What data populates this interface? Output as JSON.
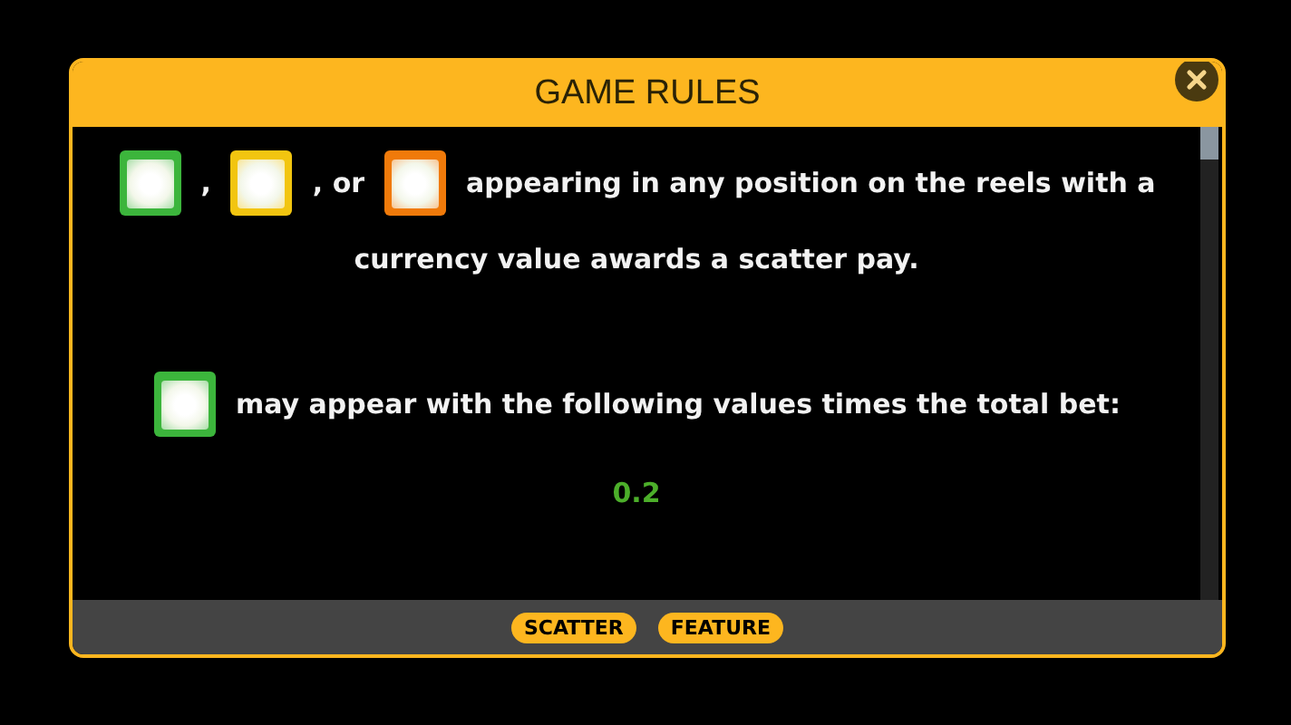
{
  "dialog": {
    "title": "GAME RULES"
  },
  "rules": [
    {
      "lines": [
        [
          {
            "kind": "symbol",
            "color": "#3cb53c"
          },
          {
            "kind": "text",
            "text": ","
          },
          {
            "kind": "symbol",
            "color": "#f2c510"
          },
          {
            "kind": "text",
            "text": ", or"
          },
          {
            "kind": "symbol",
            "color": "#f07a0a"
          },
          {
            "kind": "text",
            "text": "appearing in any position on the reels with a"
          }
        ],
        [
          {
            "kind": "text",
            "text": "currency value awards a scatter pay."
          }
        ]
      ]
    },
    {
      "lines": [
        [
          {
            "kind": "symbol",
            "color": "#3cb53c"
          },
          {
            "kind": "text",
            "text": "may appear with the following values times the total bet:"
          }
        ]
      ],
      "values": [
        "0.2"
      ]
    }
  ],
  "footer_tabs": [
    {
      "label": "SCATTER"
    },
    {
      "label": "FEATURE"
    }
  ]
}
